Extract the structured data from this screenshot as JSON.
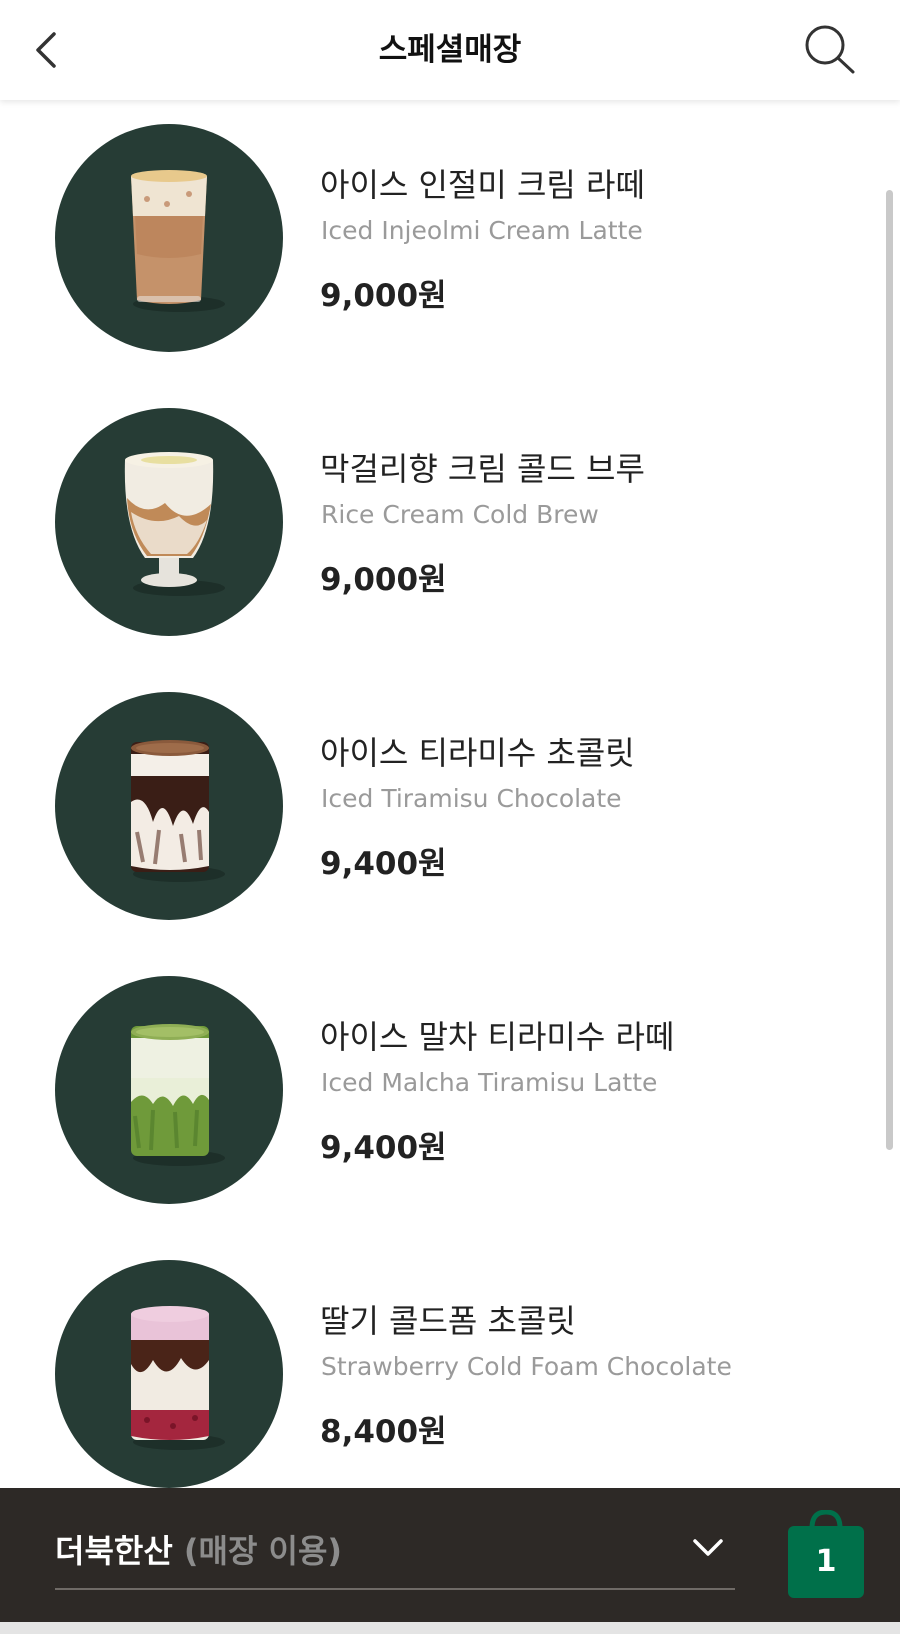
{
  "header": {
    "title": "스페셜매장",
    "back_icon": "chevron-left-icon",
    "search_icon": "search-icon"
  },
  "menu": {
    "items": [
      {
        "name": "아이스 인절미 크림 라떼",
        "english": "Iced Injeolmi Cream Latte",
        "price": "9,000원"
      },
      {
        "name": "막걸리향 크림 콜드 브루",
        "english": "Rice Cream Cold Brew",
        "price": "9,000원"
      },
      {
        "name": "아이스 티라미수 초콜릿",
        "english": "Iced Tiramisu Chocolate",
        "price": "9,400원"
      },
      {
        "name": "아이스 말차 티라미수 라떼",
        "english": "Iced Malcha Tiramisu Latte",
        "price": "9,400원"
      },
      {
        "name": "딸기 콜드폼 초콜릿",
        "english": "Strawberry Cold Foam Chocolate",
        "price": "8,400원"
      }
    ]
  },
  "bottom_bar": {
    "store_name": "더북한산",
    "store_mode": "(매장 이용)",
    "dropdown_icon": "chevron-down-icon",
    "cart_icon": "shopping-bag-icon",
    "cart_count": "1"
  },
  "colors": {
    "thumb_background": "#263c35",
    "bottom_bar": "#2d2926",
    "cart_green": "#00704a",
    "english_text": "#9a9a9a"
  }
}
